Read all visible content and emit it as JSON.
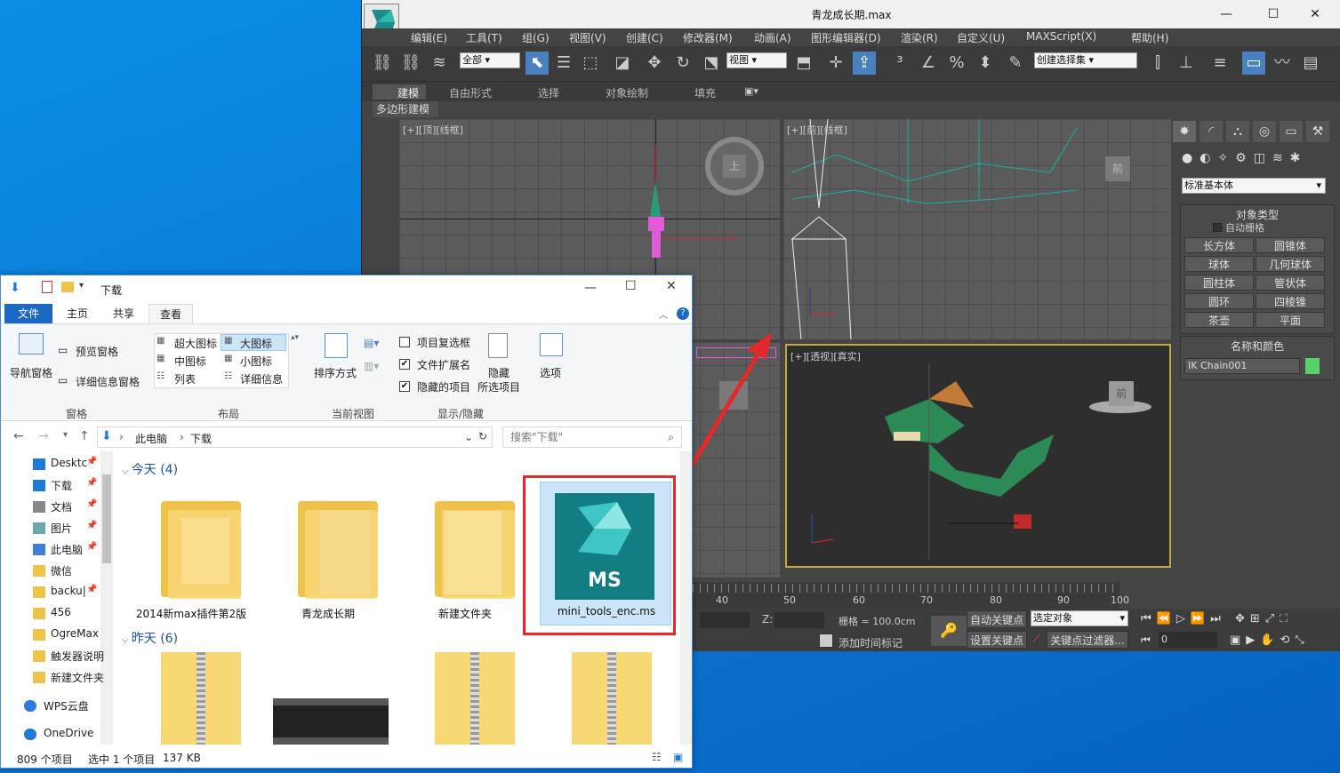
{
  "max": {
    "title": "青龙成长期.max",
    "menu": [
      "编辑(E)",
      "工具(T)",
      "组(G)",
      "视图(V)",
      "创建(C)",
      "修改器(M)",
      "动画(A)",
      "图形编辑器(D)",
      "渲染(R)",
      "自定义(U)",
      "MAXScript(X)",
      "帮助(H)"
    ],
    "toolbar": {
      "selection_filter": "全部",
      "ref_coord": "视图",
      "named_selection": "创建选择集"
    },
    "ribbon_tabs": [
      "建模",
      "自由形式",
      "选择",
      "对象绘制",
      "填充"
    ],
    "ribbon_sub": "多边形建模",
    "viewports": {
      "top": "[+][顶][线框]",
      "front": "[+][前][线框]",
      "persp": "[+][透视][真实]"
    },
    "viewcube": {
      "top": "上",
      "front": "前",
      "persp": "前"
    },
    "cmd": {
      "dropdown": "标准基本体",
      "object_type_title": "对象类型",
      "autogrid": "自动栅格",
      "buttons": [
        "长方体",
        "圆锥体",
        "球体",
        "几何球体",
        "圆柱体",
        "管状体",
        "圆环",
        "四棱锥",
        "茶壶",
        "平面"
      ],
      "name_color_title": "名称和颜色",
      "object_name": "IK Chain001",
      "object_color": "#5ad168"
    },
    "timeline_ticks": [
      "40",
      "50",
      "60",
      "70",
      "80",
      "90",
      "100"
    ],
    "status": {
      "z_label": "Z:",
      "grid": "栅格 = 100.0cm",
      "auto_key": "自动关键点",
      "selected": "选定对象",
      "set_key": "设置关键点",
      "key_filter": "关键点过滤器...",
      "add_time_tag": "添加时间标记",
      "frame": "0"
    }
  },
  "explorer": {
    "title": "下载",
    "tabs": [
      "文件",
      "主页",
      "共享",
      "查看"
    ],
    "ribbon": {
      "nav_pane": "导航窗格",
      "preview_pane": "预览窗格",
      "details_pane": "详细信息窗格",
      "group_panes": "窗格",
      "layouts": [
        "超大图标",
        "大图标",
        "中图标",
        "小图标",
        "列表",
        "详细信息"
      ],
      "group_layout": "布局",
      "sort": "排序方式",
      "group_view": "当前视图",
      "checkboxes": [
        "项目复选框",
        "文件扩展名",
        "隐藏的项目"
      ],
      "hide_selected": "隐藏",
      "hide_selected2": "所选项目",
      "group_show": "显示/隐藏",
      "options": "选项"
    },
    "address": {
      "pc": "此电脑",
      "folder": "下载"
    },
    "search_placeholder": "搜索\"下载\"",
    "nav": [
      "Desktc",
      "下载",
      "文档",
      "图片",
      "此电脑",
      "微信",
      "backu|",
      "456",
      "OgreMax",
      "触发器说明",
      "新建文件夹",
      "WPS云盘",
      "OneDrive"
    ],
    "group_today": "今天 (4)",
    "group_yesterday": "昨天 (6)",
    "files": [
      "2014新max插件第2版",
      "青龙成长期",
      "新建文件夹",
      "mini_tools_enc.ms"
    ],
    "ms_badge": "MS",
    "status": {
      "count": "809 个项目",
      "selected": "选中 1 个项目",
      "size": "137 KB"
    }
  }
}
